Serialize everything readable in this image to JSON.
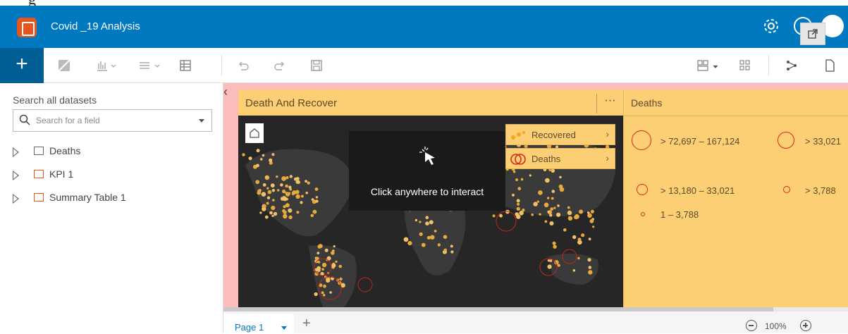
{
  "app": {
    "title": "Covid _19 Analysis"
  },
  "toolbar": {
    "add_label": "+"
  },
  "sidebar": {
    "title": "Search all datasets",
    "search_placeholder": "Search for a field",
    "datasets": [
      {
        "label": "Deaths",
        "icon": "table-icon"
      },
      {
        "label": "KPI 1",
        "icon": "kpi-icon"
      },
      {
        "label": "Summary Table 1",
        "icon": "summary-table-icon"
      }
    ]
  },
  "card_map": {
    "title": "Death And Recover",
    "menu": "···",
    "overlay_text": "Click anywhere to interact",
    "layers": [
      {
        "label": "Recovered",
        "color": "#f5a623"
      },
      {
        "label": "Deaths",
        "color": "#d4281b"
      }
    ]
  },
  "card_legend": {
    "title": "Deaths",
    "classes": [
      "> 72,697 – 167,124",
      "> 33,021",
      "> 13,180 – 33,021",
      "> 3,788",
      "1 – 3,788"
    ]
  },
  "pages": {
    "current": "Page 1",
    "add": "+"
  },
  "zoom": {
    "level": "100%"
  },
  "colors": {
    "header": "#0079c1",
    "accent": "#005e95",
    "card": "#fdcf75",
    "canvas": "#fbbcbc",
    "map": "#262626"
  }
}
